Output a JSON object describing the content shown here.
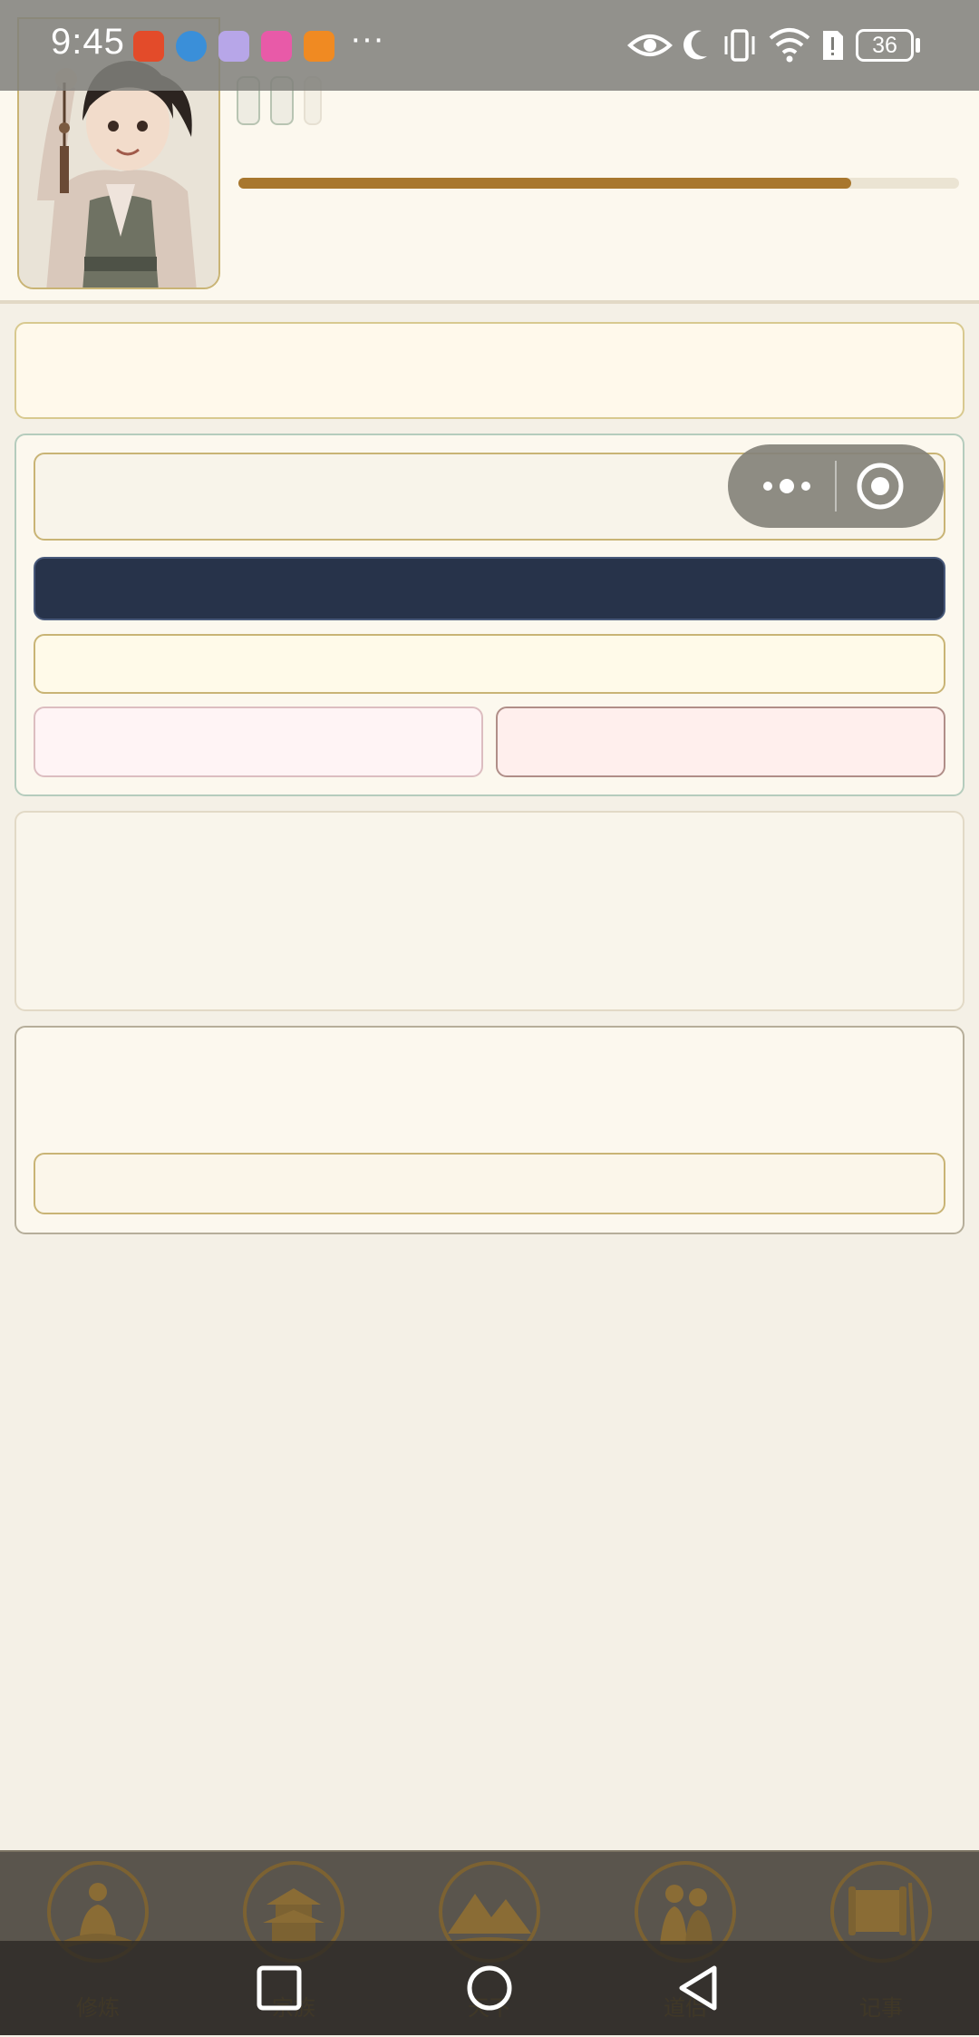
{
  "status_bar": {
    "time": "9:45",
    "more_indicator": "···",
    "battery_level": "36",
    "app_icons": [
      {
        "name": "xiaohongshu-app-icon",
        "color": "#e34b2a"
      },
      {
        "name": "browser-app-icon",
        "color": "#3a8fd9"
      },
      {
        "name": "music-app-icon",
        "color": "#b7a6e8"
      },
      {
        "name": "gallery-app-icon",
        "color": "#e85aa8"
      },
      {
        "name": "video-app-icon",
        "color": "#f08a22"
      }
    ],
    "right_icons": [
      "eye-icon",
      "moon-icon",
      "vibrate-icon",
      "wifi-icon",
      "alert-icon"
    ]
  },
  "header": {
    "progress_fraction": 0.85,
    "progress_color": "#a8772e"
  },
  "floating_capsule": {
    "more_icon": "more-dots-icon",
    "close_icon": "target-icon"
  },
  "tab_bar": {
    "tabs": [
      {
        "label": "修炼",
        "icon": "meditation-icon"
      },
      {
        "label": "宗族",
        "icon": "pavilion-icon"
      },
      {
        "label": "天下",
        "icon": "mountains-icon"
      },
      {
        "label": "道侣",
        "icon": "couple-icon"
      },
      {
        "label": "记事",
        "icon": "scroll-icon"
      }
    ]
  },
  "colors": {
    "page_background": "#f4f0e6",
    "accent_gold": "#c9b475",
    "dark_button": "#27334a",
    "tab_bar": "#5a554d"
  }
}
